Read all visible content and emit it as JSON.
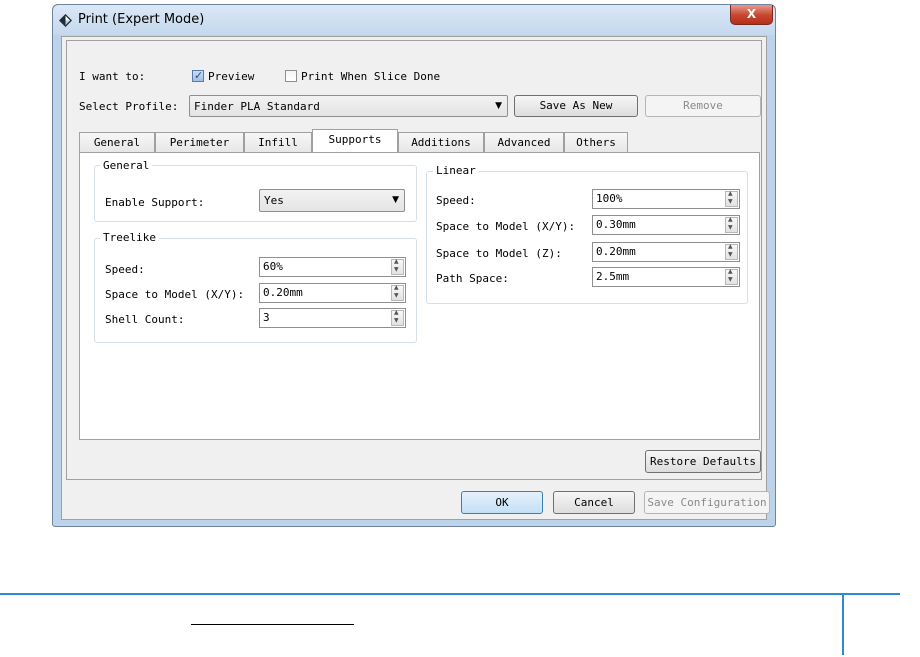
{
  "window": {
    "title": "Print (Expert Mode)",
    "close_label": "X"
  },
  "top": {
    "i_want_to_label": "I want to:",
    "preview_label": "Preview",
    "preview_checked": true,
    "print_when_done_label": "Print When Slice Done",
    "print_when_done_checked": false,
    "select_profile_label": "Select Profile:",
    "profile_value": "Finder PLA Standard",
    "save_as_new_label": "Save As New",
    "remove_label": "Remove"
  },
  "tabs": [
    {
      "label": "General"
    },
    {
      "label": "Perimeter"
    },
    {
      "label": "Infill"
    },
    {
      "label": "Supports",
      "active": true
    },
    {
      "label": "Additions"
    },
    {
      "label": "Advanced"
    },
    {
      "label": "Others"
    }
  ],
  "general_group": {
    "title": "General",
    "enable_support_label": "Enable Support:",
    "enable_support_value": "Yes"
  },
  "treelike_group": {
    "title": "Treelike",
    "speed_label": "Speed:",
    "speed_value": "60%",
    "space_xy_label": "Space to Model (X/Y):",
    "space_xy_value": "0.20mm",
    "shell_count_label": "Shell Count:",
    "shell_count_value": "3"
  },
  "linear_group": {
    "title": "Linear",
    "speed_label": "Speed:",
    "speed_value": "100%",
    "space_xy_label": "Space to Model (X/Y):",
    "space_xy_value": "0.30mm",
    "space_z_label": "Space to Model (Z):",
    "space_z_value": "0.20mm",
    "path_space_label": "Path Space:",
    "path_space_value": "2.5mm"
  },
  "footer": {
    "restore_defaults_label": "Restore Defaults",
    "ok_label": "OK",
    "cancel_label": "Cancel",
    "save_configuration_label": "Save Configuration"
  },
  "colors": {
    "accent_line": "#2f8bd0",
    "window_frame": "#bcd3ea",
    "close_button": "#c7452f"
  }
}
